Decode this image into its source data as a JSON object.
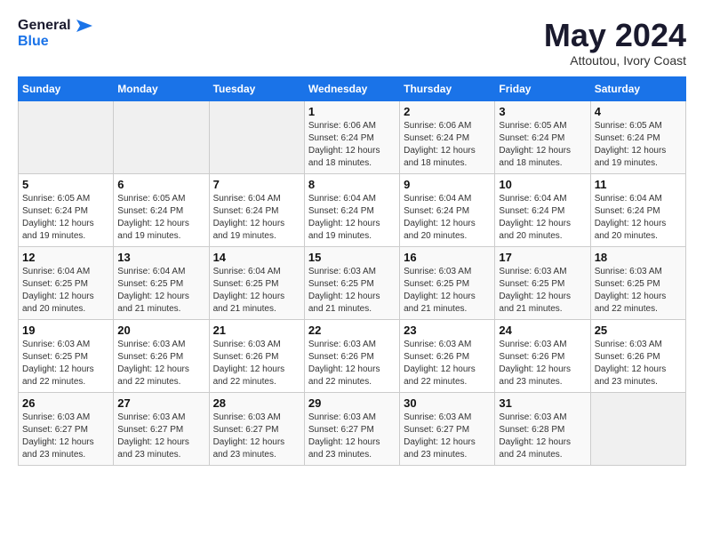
{
  "header": {
    "logo_line1": "General",
    "logo_line2": "Blue",
    "month_year": "May 2024",
    "location": "Attoutou, Ivory Coast"
  },
  "days_of_week": [
    "Sunday",
    "Monday",
    "Tuesday",
    "Wednesday",
    "Thursday",
    "Friday",
    "Saturday"
  ],
  "weeks": [
    [
      {
        "day": "",
        "info": ""
      },
      {
        "day": "",
        "info": ""
      },
      {
        "day": "",
        "info": ""
      },
      {
        "day": "1",
        "info": "Sunrise: 6:06 AM\nSunset: 6:24 PM\nDaylight: 12 hours and 18 minutes."
      },
      {
        "day": "2",
        "info": "Sunrise: 6:06 AM\nSunset: 6:24 PM\nDaylight: 12 hours and 18 minutes."
      },
      {
        "day": "3",
        "info": "Sunrise: 6:05 AM\nSunset: 6:24 PM\nDaylight: 12 hours and 18 minutes."
      },
      {
        "day": "4",
        "info": "Sunrise: 6:05 AM\nSunset: 6:24 PM\nDaylight: 12 hours and 19 minutes."
      }
    ],
    [
      {
        "day": "5",
        "info": "Sunrise: 6:05 AM\nSunset: 6:24 PM\nDaylight: 12 hours and 19 minutes."
      },
      {
        "day": "6",
        "info": "Sunrise: 6:05 AM\nSunset: 6:24 PM\nDaylight: 12 hours and 19 minutes."
      },
      {
        "day": "7",
        "info": "Sunrise: 6:04 AM\nSunset: 6:24 PM\nDaylight: 12 hours and 19 minutes."
      },
      {
        "day": "8",
        "info": "Sunrise: 6:04 AM\nSunset: 6:24 PM\nDaylight: 12 hours and 19 minutes."
      },
      {
        "day": "9",
        "info": "Sunrise: 6:04 AM\nSunset: 6:24 PM\nDaylight: 12 hours and 20 minutes."
      },
      {
        "day": "10",
        "info": "Sunrise: 6:04 AM\nSunset: 6:24 PM\nDaylight: 12 hours and 20 minutes."
      },
      {
        "day": "11",
        "info": "Sunrise: 6:04 AM\nSunset: 6:24 PM\nDaylight: 12 hours and 20 minutes."
      }
    ],
    [
      {
        "day": "12",
        "info": "Sunrise: 6:04 AM\nSunset: 6:25 PM\nDaylight: 12 hours and 20 minutes."
      },
      {
        "day": "13",
        "info": "Sunrise: 6:04 AM\nSunset: 6:25 PM\nDaylight: 12 hours and 21 minutes."
      },
      {
        "day": "14",
        "info": "Sunrise: 6:04 AM\nSunset: 6:25 PM\nDaylight: 12 hours and 21 minutes."
      },
      {
        "day": "15",
        "info": "Sunrise: 6:03 AM\nSunset: 6:25 PM\nDaylight: 12 hours and 21 minutes."
      },
      {
        "day": "16",
        "info": "Sunrise: 6:03 AM\nSunset: 6:25 PM\nDaylight: 12 hours and 21 minutes."
      },
      {
        "day": "17",
        "info": "Sunrise: 6:03 AM\nSunset: 6:25 PM\nDaylight: 12 hours and 21 minutes."
      },
      {
        "day": "18",
        "info": "Sunrise: 6:03 AM\nSunset: 6:25 PM\nDaylight: 12 hours and 22 minutes."
      }
    ],
    [
      {
        "day": "19",
        "info": "Sunrise: 6:03 AM\nSunset: 6:25 PM\nDaylight: 12 hours and 22 minutes."
      },
      {
        "day": "20",
        "info": "Sunrise: 6:03 AM\nSunset: 6:26 PM\nDaylight: 12 hours and 22 minutes."
      },
      {
        "day": "21",
        "info": "Sunrise: 6:03 AM\nSunset: 6:26 PM\nDaylight: 12 hours and 22 minutes."
      },
      {
        "day": "22",
        "info": "Sunrise: 6:03 AM\nSunset: 6:26 PM\nDaylight: 12 hours and 22 minutes."
      },
      {
        "day": "23",
        "info": "Sunrise: 6:03 AM\nSunset: 6:26 PM\nDaylight: 12 hours and 22 minutes."
      },
      {
        "day": "24",
        "info": "Sunrise: 6:03 AM\nSunset: 6:26 PM\nDaylight: 12 hours and 23 minutes."
      },
      {
        "day": "25",
        "info": "Sunrise: 6:03 AM\nSunset: 6:26 PM\nDaylight: 12 hours and 23 minutes."
      }
    ],
    [
      {
        "day": "26",
        "info": "Sunrise: 6:03 AM\nSunset: 6:27 PM\nDaylight: 12 hours and 23 minutes."
      },
      {
        "day": "27",
        "info": "Sunrise: 6:03 AM\nSunset: 6:27 PM\nDaylight: 12 hours and 23 minutes."
      },
      {
        "day": "28",
        "info": "Sunrise: 6:03 AM\nSunset: 6:27 PM\nDaylight: 12 hours and 23 minutes."
      },
      {
        "day": "29",
        "info": "Sunrise: 6:03 AM\nSunset: 6:27 PM\nDaylight: 12 hours and 23 minutes."
      },
      {
        "day": "30",
        "info": "Sunrise: 6:03 AM\nSunset: 6:27 PM\nDaylight: 12 hours and 23 minutes."
      },
      {
        "day": "31",
        "info": "Sunrise: 6:03 AM\nSunset: 6:28 PM\nDaylight: 12 hours and 24 minutes."
      },
      {
        "day": "",
        "info": ""
      }
    ]
  ]
}
